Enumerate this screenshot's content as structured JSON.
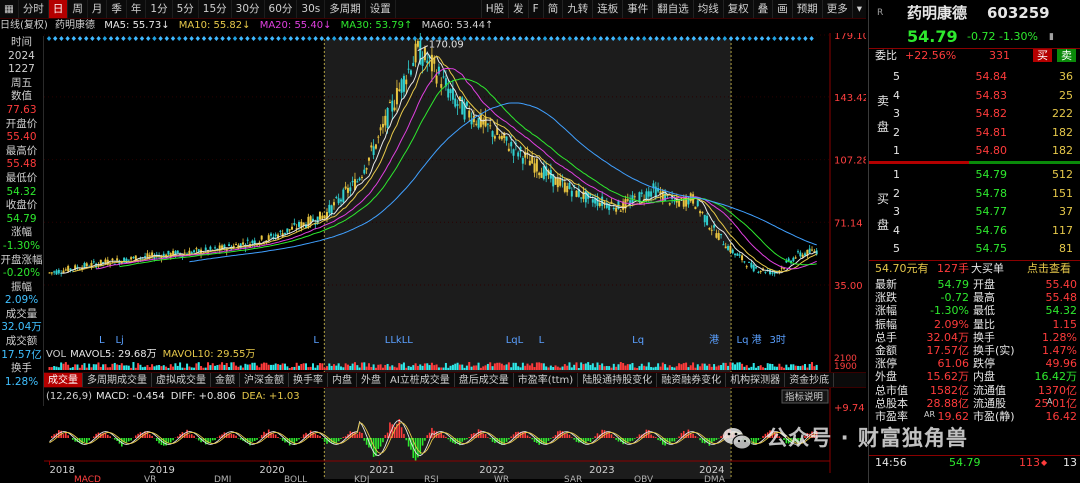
{
  "toolbar": {
    "items": [
      "分时",
      "日",
      "周",
      "月",
      "季",
      "年",
      "1分",
      "5分",
      "15分",
      "30分",
      "60分",
      "30s",
      "多周期",
      "设置"
    ],
    "active_index": 1,
    "right_items": [
      "H股",
      "发",
      "F",
      "简",
      "九转",
      "连板",
      "事件",
      "翻自选",
      "均线",
      "复权",
      "叠",
      "画",
      "预期",
      "更多"
    ]
  },
  "infoline": {
    "mode": "日线(复权)",
    "name": "药明康德",
    "ma5": "MA5: 55.73↓",
    "ma10": "MA10: 55.82↓",
    "ma20": "MA20: 55.40↓",
    "ma30": "MA30: 53.79↑",
    "ma60": "MA60: 53.44↑"
  },
  "readout": [
    {
      "label": "时间",
      "value": "2024",
      "cls": "lbl"
    },
    {
      "label": "",
      "value": "1227",
      "cls": "lbl"
    },
    {
      "label": "",
      "value": "周五",
      "cls": "lbl"
    },
    {
      "label": "数值",
      "value": "77.63",
      "cls": "r"
    },
    {
      "label": "开盘价",
      "value": "55.40",
      "cls": "r"
    },
    {
      "label": "最高价",
      "value": "55.48",
      "cls": "r"
    },
    {
      "label": "最低价",
      "value": "54.32",
      "cls": "g"
    },
    {
      "label": "收盘价",
      "value": "54.79",
      "cls": "g"
    },
    {
      "label": "涨幅",
      "value": "-1.30%",
      "cls": "g"
    },
    {
      "label": "开盘涨幅",
      "value": "-0.20%",
      "cls": "g"
    },
    {
      "label": "振幅",
      "value": "2.09%",
      "cls": "c"
    },
    {
      "label": "成交量",
      "value": "32.04万",
      "cls": "c"
    },
    {
      "label": "成交额",
      "value": "17.57亿",
      "cls": "c"
    },
    {
      "label": "换手",
      "value": "1.28%",
      "cls": "c"
    }
  ],
  "chart": {
    "y_ticks": [
      "179.10",
      "143.42",
      "107.28",
      "71.14",
      "35.00"
    ],
    "peak_label": "170.09",
    "years": [
      "2018",
      "2019",
      "2020",
      "2021",
      "2022",
      "2023",
      "2024"
    ],
    "vol_legend": {
      "vol": "VOL",
      "mavol5": "MAVOL5: 29.68万",
      "mavol10": "MAVOL10: 29.55万"
    },
    "vol_ticks": [
      "2100",
      "1900"
    ],
    "macd_legend": {
      "params": "(12,26,9)",
      "macd": "MACD: -0.454",
      "diff": "DIFF: +0.806",
      "dea": "DEA: +1.03"
    },
    "macd_tick": "+9.74",
    "help_btn": "指标说明",
    "event_marks": [
      "L",
      "Lj",
      "L",
      "LLkLL",
      "LqL",
      "L",
      "Lq",
      "港",
      "Lq 港",
      "3时"
    ],
    "bottom_icons": [
      "设置",
      "MACD",
      "VR",
      "DMI",
      "BOLL",
      "KDJ",
      "RSI",
      "WR",
      "SAR",
      "OBV",
      "DMA"
    ]
  },
  "chart_data": {
    "type": "candlestick",
    "title": "药明康德 日线(复权)",
    "ylim": [
      35.0,
      179.1
    ],
    "x": [
      "2018",
      "2019",
      "2020",
      "2021",
      "2022",
      "2023",
      "2024"
    ],
    "close_path_years": [
      2018.0,
      2018.5,
      2019.0,
      2019.5,
      2020.0,
      2020.5,
      2020.8,
      2021.0,
      2021.2,
      2021.35,
      2021.5,
      2021.7,
      2022.0,
      2022.3,
      2022.6,
      2022.9,
      2023.2,
      2023.5,
      2023.7,
      2023.85,
      2024.0,
      2024.2,
      2024.4,
      2024.6,
      2024.8,
      2025.0
    ],
    "close_path_values": [
      42,
      48,
      52,
      55,
      62,
      75,
      95,
      120,
      150,
      170,
      160,
      140,
      125,
      110,
      95,
      85,
      80,
      90,
      82,
      85,
      70,
      55,
      45,
      42,
      52,
      55
    ],
    "peak": 170.09
  },
  "tabs": [
    "成交量",
    "多周期成交量",
    "虚拟成交量",
    "金额",
    "沪深金额",
    "换手率",
    "内盘",
    "外盘",
    "AI立桩成交量",
    "盘后成交量",
    "市盈率(ttm)",
    "陆股通持股变化",
    "融资融券变化",
    "机构探测器",
    "资金抄底"
  ],
  "tabs_active_index": 0,
  "rpanel": {
    "market": "R",
    "name": "药明康德",
    "code": "603259",
    "price": "54.79",
    "change": "-0.72",
    "pct": "-1.30%",
    "webi_label": "委比",
    "webi": "+22.56%",
    "webi_diff": "331",
    "buy_btn": "买",
    "sell_btn": "卖",
    "sell_side_label": [
      "卖",
      "盘"
    ],
    "buy_side_label": [
      "买",
      "盘"
    ],
    "asks": [
      {
        "lvl": "5",
        "price": "54.84",
        "vol": "36"
      },
      {
        "lvl": "4",
        "price": "54.83",
        "vol": "25"
      },
      {
        "lvl": "3",
        "price": "54.82",
        "vol": "222"
      },
      {
        "lvl": "2",
        "price": "54.81",
        "vol": "182"
      },
      {
        "lvl": "1",
        "price": "54.80",
        "vol": "182"
      }
    ],
    "bids": [
      {
        "lvl": "1",
        "price": "54.79",
        "vol": "512"
      },
      {
        "lvl": "2",
        "price": "54.78",
        "vol": "151"
      },
      {
        "lvl": "3",
        "price": "54.77",
        "vol": "37"
      },
      {
        "lvl": "4",
        "price": "54.76",
        "vol": "117"
      },
      {
        "lvl": "5",
        "price": "54.75",
        "vol": "81"
      }
    ],
    "big_order": {
      "price": "54.70元有",
      "hands": "127手",
      "label": "大买单",
      "link": "点击查看"
    },
    "stats": [
      [
        "最新",
        "54.79",
        "开盘",
        "55.40"
      ],
      [
        "涨跌",
        "-0.72",
        "最高",
        "55.48"
      ],
      [
        "涨幅",
        "-1.30%",
        "最低",
        "54.32"
      ],
      [
        "振幅",
        "2.09%",
        "量比",
        "1.15"
      ],
      [
        "总手",
        "32.04万",
        "换手",
        "1.28%"
      ],
      [
        "金额",
        "17.57亿",
        "换手(实)",
        "1.47%"
      ],
      [
        "涨停",
        "61.06",
        "跌停",
        "49.96"
      ],
      [
        "外盘",
        "15.62万",
        "内盘",
        "16.42万"
      ],
      [
        "总市值",
        "1582亿",
        "流通值",
        "1370亿"
      ],
      [
        "总股本",
        "28.88亿",
        "流通股",
        "25.01亿"
      ],
      [
        "市盈率",
        "19.62",
        "市盈(静)",
        "16.42"
      ]
    ],
    "stat_badge_a": "A",
    "stat_badge_ar": "AR",
    "ticks": [
      {
        "time": "14:56",
        "price": "54.79",
        "vol": "113",
        "arrow": "◆",
        "n": "13"
      }
    ]
  },
  "watermark": "公众号 · 财富独角兽"
}
